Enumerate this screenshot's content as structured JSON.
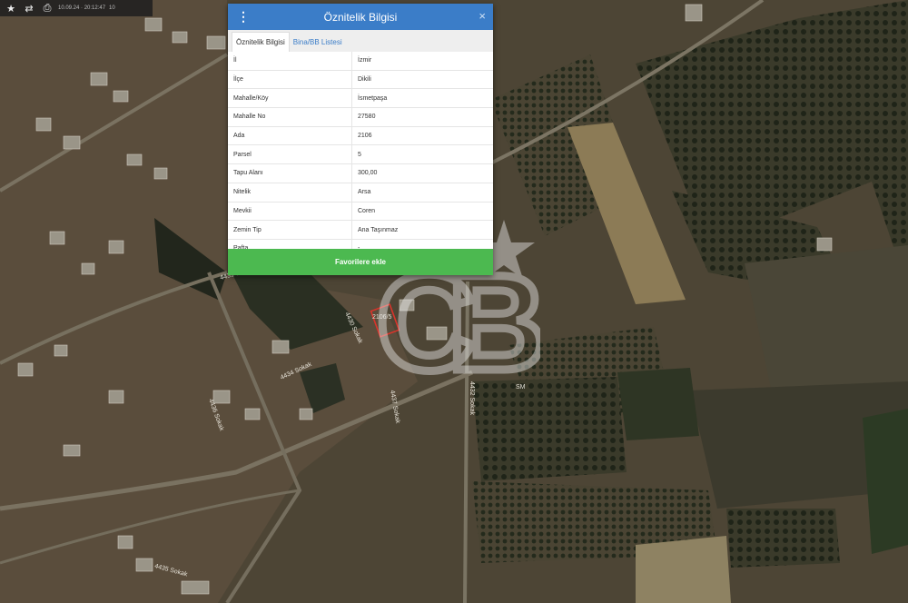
{
  "toolbar": {
    "timestamp": "10.09.24 · 20:12:47",
    "page_number": "10"
  },
  "panel": {
    "title": "Öznitelik Bilgisi",
    "tabs": [
      "Öznitelik Bilgisi",
      "Bina/BB Listesi"
    ],
    "rows": [
      {
        "key": "İl",
        "value": "İzmir"
      },
      {
        "key": "İlçe",
        "value": "Dikili"
      },
      {
        "key": "Mahalle/Köy",
        "value": "İsmetpaşa"
      },
      {
        "key": "Mahalle No",
        "value": "27580"
      },
      {
        "key": "Ada",
        "value": "2106"
      },
      {
        "key": "Parsel",
        "value": "5"
      },
      {
        "key": "Tapu Alanı",
        "value": "300,00"
      },
      {
        "key": "Nitelik",
        "value": "Arsa"
      },
      {
        "key": "Mevkii",
        "value": "Coren"
      },
      {
        "key": "Zemin Tip",
        "value": "Ana Taşınmaz"
      },
      {
        "key": "Pafta",
        "value": "-"
      }
    ],
    "favorite_button": "Favorilere ekle"
  },
  "map_labels": {
    "parcel_label": "2106/5",
    "road_labels": [
      "4431 Sokak",
      "4430 Sokak",
      "4434 Sokak",
      "4436 Sokak",
      "4437 Sokak",
      "4435 Sokak",
      "4432 Sokak"
    ],
    "sm_label": "SM"
  },
  "watermark": {
    "letters": "CB"
  },
  "icons": {
    "menu": "vertical-dots-icon",
    "close": "close-icon",
    "star": "star-icon",
    "arrow": "double-arrow-icon",
    "print": "print-icon"
  },
  "colors": {
    "header": "#3b7dc8",
    "favorite": "#4cb950",
    "parcel_outline": "#d9342b"
  }
}
